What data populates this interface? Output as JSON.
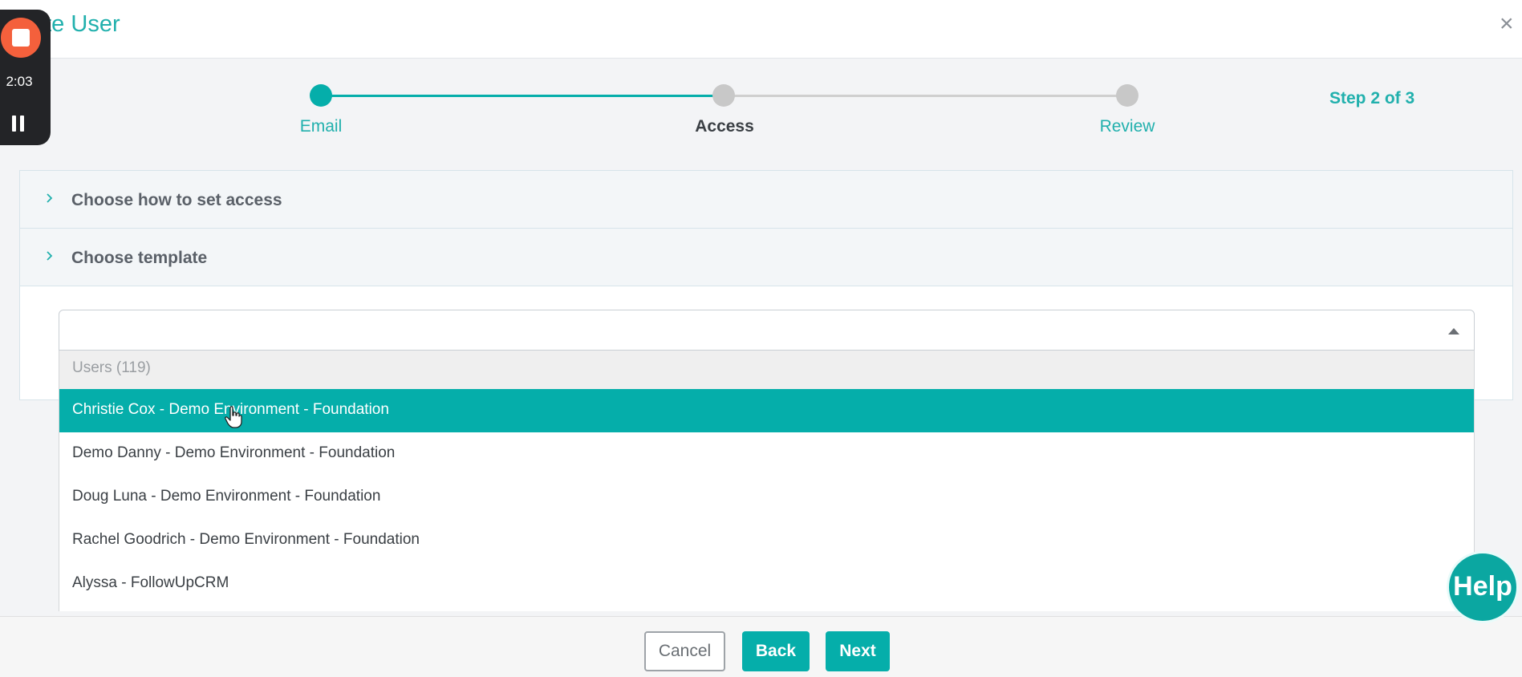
{
  "header": {
    "title": "ate User",
    "close_label": "×"
  },
  "recorder": {
    "time": "2:03"
  },
  "stepper": {
    "steps": [
      {
        "label": "Email",
        "state": "complete"
      },
      {
        "label": "Access",
        "state": "current"
      },
      {
        "label": "Review",
        "state": "upcoming"
      }
    ],
    "step_count": "Step 2 of 3"
  },
  "accordion": {
    "sections": [
      {
        "label": "Choose how to set access"
      },
      {
        "label": "Choose template"
      }
    ]
  },
  "template_select": {
    "value": "",
    "group_label": "Users (119)",
    "options": [
      {
        "label": "Christie Cox - Demo Environment - Foundation",
        "selected": true
      },
      {
        "label": "Demo Danny - Demo Environment - Foundation",
        "selected": false
      },
      {
        "label": "Doug Luna - Demo Environment - Foundation",
        "selected": false
      },
      {
        "label": "Rachel Goodrich - Demo Environment - Foundation",
        "selected": false
      },
      {
        "label": "Alyssa - FollowUpCRM",
        "selected": false
      }
    ]
  },
  "footer": {
    "cancel_label": "Cancel",
    "back_label": "Back",
    "next_label": "Next"
  },
  "help": {
    "label": "Help"
  },
  "colors": {
    "accent": "#05aeaa",
    "recorder_stop": "#f4603c",
    "inactive": "#c8c8c8"
  }
}
